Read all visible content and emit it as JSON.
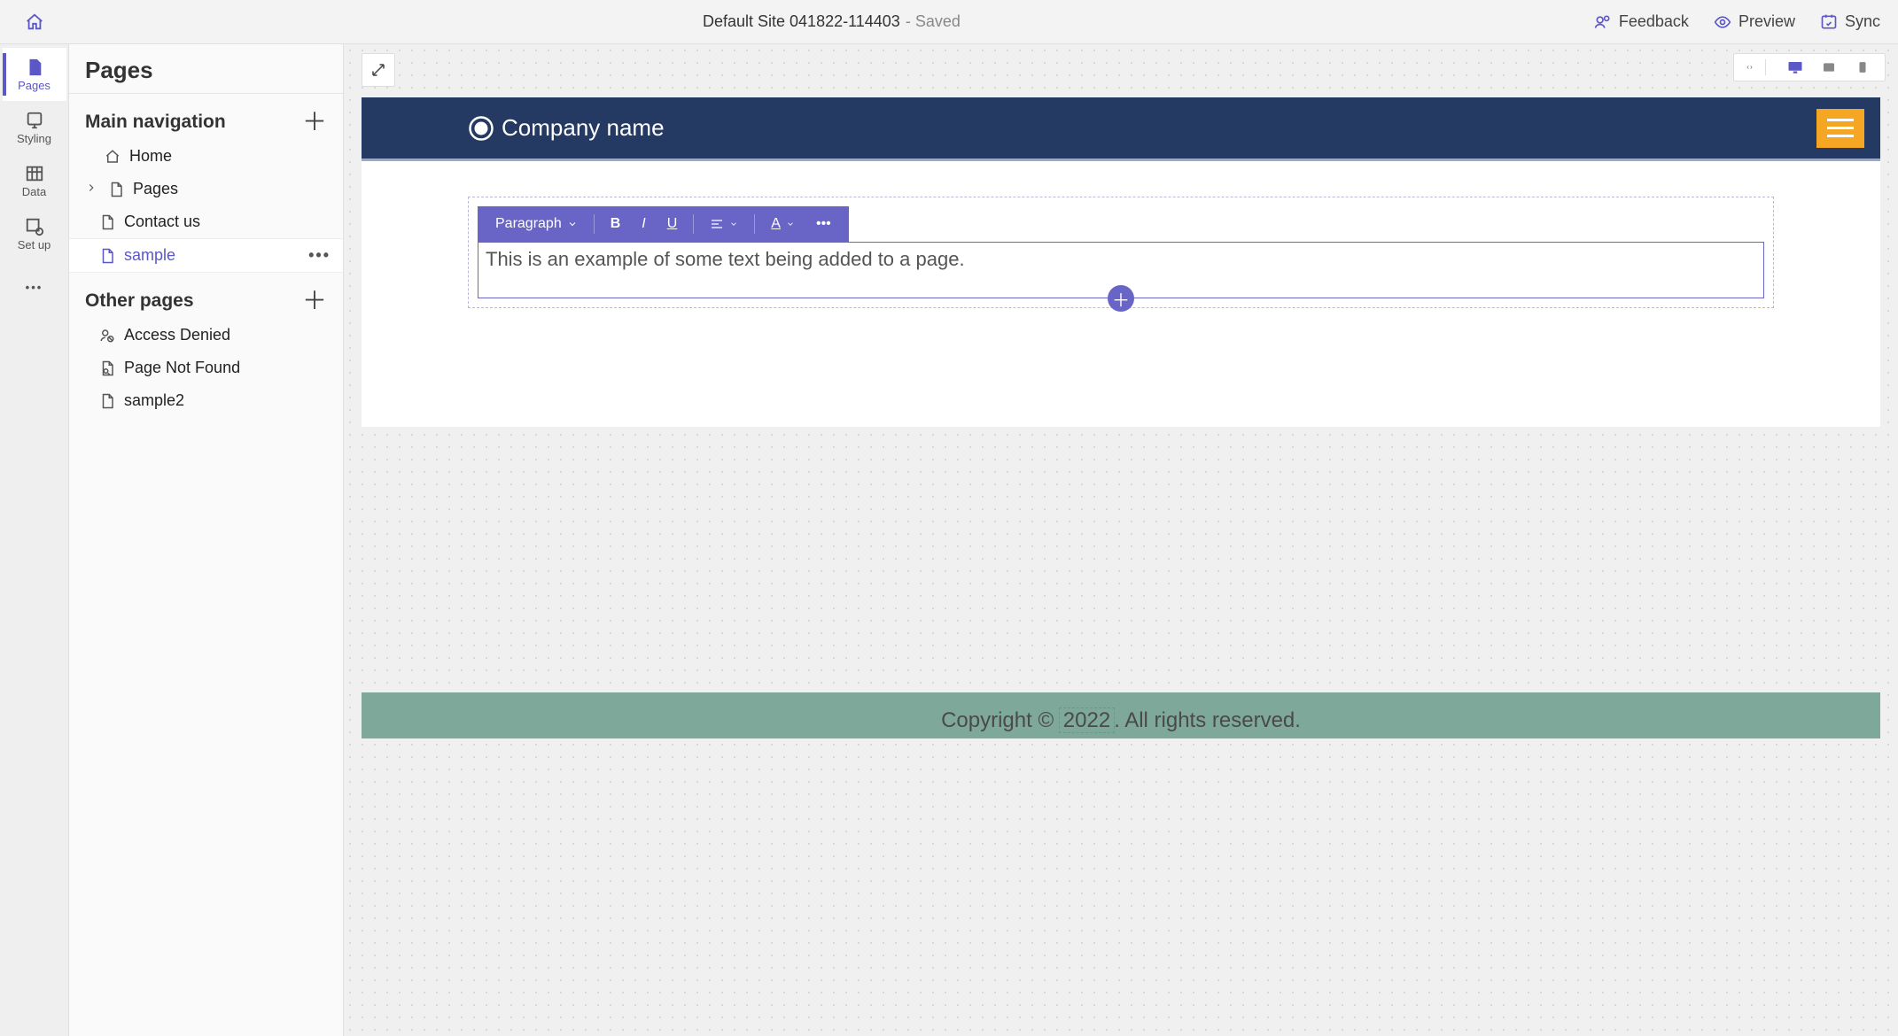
{
  "topbar": {
    "site_title": "Default Site 041822-114403",
    "saved_label": "- Saved",
    "actions": {
      "feedback": "Feedback",
      "preview": "Preview",
      "sync": "Sync"
    }
  },
  "rail": {
    "pages": "Pages",
    "styling": "Styling",
    "data": "Data",
    "setup": "Set up"
  },
  "panel": {
    "title": "Pages",
    "sections": {
      "main_nav": {
        "title": "Main navigation",
        "items": {
          "home": "Home",
          "pages": "Pages",
          "contact": "Contact us",
          "sample": "sample"
        }
      },
      "other": {
        "title": "Other pages",
        "items": {
          "access_denied": "Access Denied",
          "not_found": "Page Not Found",
          "sample2": "sample2"
        }
      }
    }
  },
  "editor": {
    "block_style": "Paragraph"
  },
  "preview": {
    "company_name": "Company name",
    "body_text": "This is an example of some text being added to a page.",
    "footer_prefix": "Copyright © ",
    "footer_year": "2022",
    "footer_suffix": ". All rights reserved."
  },
  "colors": {
    "accent": "#5b57c7",
    "header_bg": "#243a62",
    "burger": "#f5a623",
    "footer": "#7ea99a"
  }
}
